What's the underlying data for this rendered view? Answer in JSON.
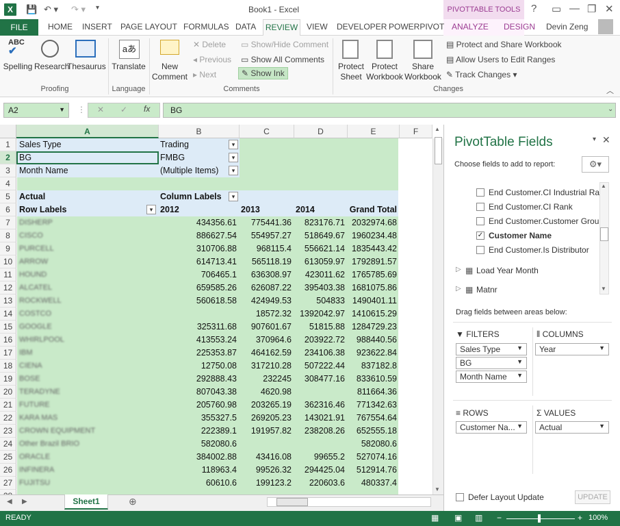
{
  "window": {
    "title": "Book1 - Excel",
    "context_tab_group": "PIVOTTABLE TOOLS",
    "user": "Devin Zeng",
    "close": "✕",
    "minimize": "—",
    "restore": "❐",
    "help": "?"
  },
  "tabs": {
    "file": "FILE",
    "home": "HOME",
    "insert": "INSERT",
    "page_layout": "PAGE LAYOUT",
    "formulas": "FORMULAS",
    "data": "DATA",
    "review": "REVIEW",
    "view": "VIEW",
    "developer": "DEVELOPER",
    "powerpivot": "POWERPIVOT",
    "analyze": "ANALYZE",
    "design": "DESIGN"
  },
  "ribbon": {
    "spelling": "Spelling",
    "research": "Research",
    "thesaurus": "Thesaurus",
    "proofing": "Proofing",
    "translate": "Translate",
    "language": "Language",
    "new_comment_1": "New",
    "new_comment_2": "Comment",
    "delete": "Delete",
    "previous": "Previous",
    "next": "Next",
    "show_hide_comment": "Show/Hide Comment",
    "show_all_comments": "Show All Comments",
    "show_ink": "Show Ink",
    "comments": "Comments",
    "protect_sheet_1": "Protect",
    "protect_sheet_2": "Sheet",
    "protect_wb_1": "Protect",
    "protect_wb_2": "Workbook",
    "share_wb_1": "Share",
    "share_wb_2": "Workbook",
    "protect_share": "Protect and Share Workbook",
    "allow_users": "Allow Users to Edit Ranges",
    "track_changes": "Track Changes",
    "changes": "Changes"
  },
  "formula_bar": {
    "name_box": "A2",
    "formula": "BG",
    "fx": "fx"
  },
  "columns": [
    "A",
    "B",
    "C",
    "D",
    "E",
    "F"
  ],
  "rows": [
    "1",
    "2",
    "3",
    "4",
    "5",
    "6",
    "7",
    "8",
    "9",
    "10",
    "11",
    "12",
    "13",
    "14",
    "15",
    "16",
    "17",
    "18",
    "19",
    "20",
    "21",
    "22",
    "23",
    "24",
    "25",
    "26",
    "27",
    "28"
  ],
  "filters": [
    {
      "label": "Sales Type",
      "value": "Trading"
    },
    {
      "label": "BG",
      "value": "FMBG"
    },
    {
      "label": "Month Name",
      "value": "(Multiple Items)"
    }
  ],
  "pivot_header": {
    "values_label": "Actual",
    "column_labels": "Column Labels",
    "row_labels": "Row Labels",
    "years": [
      "2012",
      "2013",
      "2014"
    ],
    "grand_total": "Grand Total"
  },
  "pivot_rows": [
    {
      "name": "DISHERP",
      "v2012": "434356.61",
      "v2013": "775441.36",
      "v2014": "823176.71",
      "total": "2032974.68"
    },
    {
      "name": "CISCO",
      "v2012": "886627.54",
      "v2013": "554957.27",
      "v2014": "518649.67",
      "total": "1960234.48"
    },
    {
      "name": "PURCELL",
      "v2012": "310706.88",
      "v2013": "968115.4",
      "v2014": "556621.14",
      "total": "1835443.42"
    },
    {
      "name": "ARROW",
      "v2012": "614713.41",
      "v2013": "565118.19",
      "v2014": "613059.97",
      "total": "1792891.57"
    },
    {
      "name": "HOUND",
      "v2012": "706465.1",
      "v2013": "636308.97",
      "v2014": "423011.62",
      "total": "1765785.69"
    },
    {
      "name": "ALCATEL",
      "v2012": "659585.26",
      "v2013": "626087.22",
      "v2014": "395403.38",
      "total": "1681075.86"
    },
    {
      "name": "ROCKWELL",
      "v2012": "560618.58",
      "v2013": "424949.53",
      "v2014": "504833",
      "total": "1490401.11"
    },
    {
      "name": "COSTCO",
      "v2012": "",
      "v2013": "18572.32",
      "v2014": "1392042.97",
      "total": "1410615.29"
    },
    {
      "name": "GOOGLE",
      "v2012": "325311.68",
      "v2013": "907601.67",
      "v2014": "51815.88",
      "total": "1284729.23"
    },
    {
      "name": "WHIRLPOOL",
      "v2012": "413553.24",
      "v2013": "370964.6",
      "v2014": "203922.72",
      "total": "988440.56"
    },
    {
      "name": "IBM",
      "v2012": "225353.87",
      "v2013": "464162.59",
      "v2014": "234106.38",
      "total": "923622.84"
    },
    {
      "name": "CIENA",
      "v2012": "12750.08",
      "v2013": "317210.28",
      "v2014": "507222.44",
      "total": "837182.8"
    },
    {
      "name": "BOSE",
      "v2012": "292888.43",
      "v2013": "232245",
      "v2014": "308477.16",
      "total": "833610.59"
    },
    {
      "name": "TERADYNE",
      "v2012": "807043.38",
      "v2013": "4620.98",
      "v2014": "",
      "total": "811664.36"
    },
    {
      "name": "FUTURE",
      "v2012": "205760.98",
      "v2013": "203265.19",
      "v2014": "362316.46",
      "total": "771342.63"
    },
    {
      "name": "KARA MAS",
      "v2012": "355327.5",
      "v2013": "269205.23",
      "v2014": "143021.91",
      "total": "767554.64"
    },
    {
      "name": "CROWN EQUIPMENT",
      "v2012": "222389.1",
      "v2013": "191957.82",
      "v2014": "238208.26",
      "total": "652555.18"
    },
    {
      "name": "Other Brazil BRIO",
      "v2012": "582080.6",
      "v2013": "",
      "v2014": "",
      "total": "582080.6"
    },
    {
      "name": "ORACLE",
      "v2012": "384002.88",
      "v2013": "43416.08",
      "v2014": "99655.2",
      "total": "527074.16"
    },
    {
      "name": "INFINERA",
      "v2012": "118963.4",
      "v2013": "99526.32",
      "v2014": "294425.04",
      "total": "512914.76"
    },
    {
      "name": "FUJITSU",
      "v2012": "60610.6",
      "v2013": "199123.2",
      "v2014": "220603.6",
      "total": "480337.4"
    }
  ],
  "sheet": {
    "tab": "Sheet1",
    "add": "⊕"
  },
  "status": {
    "ready": "READY",
    "zoom": "100%"
  },
  "pane": {
    "title": "PivotTable Fields",
    "choose": "Choose fields to add to report:",
    "fields": [
      {
        "label": "End Customer.CI Industrial Ra...",
        "checked": false
      },
      {
        "label": "End Customer.CI Rank",
        "checked": false
      },
      {
        "label": "End Customer.Customer Group",
        "checked": false
      },
      {
        "label": "Customer Name",
        "checked": true
      },
      {
        "label": "End Customer.Is Distributor",
        "checked": false
      }
    ],
    "tables": [
      "Load Year Month",
      "Matnr"
    ],
    "drag": "Drag fields between areas below:",
    "filters_hdr": "FILTERS",
    "columns_hdr": "COLUMNS",
    "rows_hdr": "ROWS",
    "values_hdr": "VALUES",
    "filter_items": [
      "Sales Type",
      "BG",
      "Month Name"
    ],
    "column_items": [
      "Year"
    ],
    "row_items": [
      "Customer Na..."
    ],
    "value_items": [
      "Actual"
    ],
    "defer": "Defer Layout Update",
    "update": "UPDATE"
  }
}
